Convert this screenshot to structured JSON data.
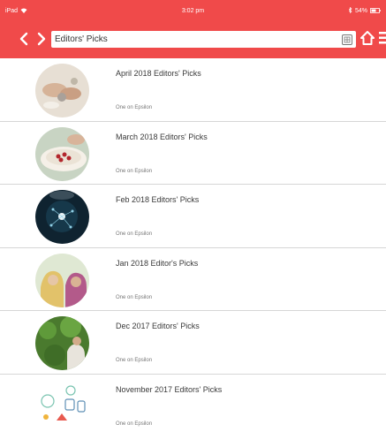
{
  "status_bar": {
    "carrier": "iPad",
    "time": "3:02 pm",
    "battery": "54%"
  },
  "nav": {
    "back_icon": "chevron-left-icon",
    "forward_icon": "chevron-right-icon",
    "search_value": "Editors' Picks",
    "bookmark_icon": "bookmark-icon",
    "home_icon": "home-icon",
    "menu_icon": "menu-icon"
  },
  "colors": {
    "accent": "#f04a4a",
    "divider": "#d6d6d6"
  },
  "items": [
    {
      "title": "April 2018 Editors' Picks",
      "author": "One on Epsilon",
      "thumb": "hands-crafting-photo"
    },
    {
      "title": "March 2018 Editors' Picks",
      "author": "One on Epsilon",
      "thumb": "food-bowl-photo"
    },
    {
      "title": "Feb 2018 Editors' Picks",
      "author": "One on Epsilon",
      "thumb": "glowing-network-photo"
    },
    {
      "title": "Jan 2018 Editor's Picks",
      "author": "One on Epsilon",
      "thumb": "women-in-headscarves-photo"
    },
    {
      "title": "Dec 2017 Editors' Picks",
      "author": "One on Epsilon",
      "thumb": "garden-leaves-photo"
    },
    {
      "title": "November 2017 Editors' Picks",
      "author": "One on Epsilon",
      "thumb": "icon-illustration"
    }
  ]
}
